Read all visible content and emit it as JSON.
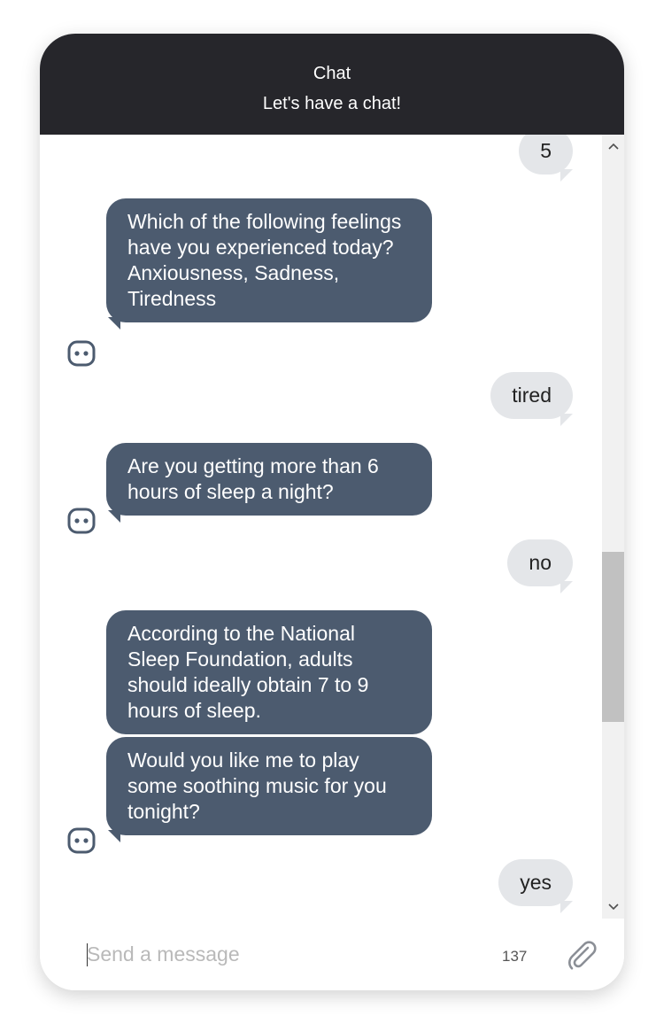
{
  "header": {
    "title": "Chat",
    "subtitle": "Let's have a chat!"
  },
  "messages": [
    {
      "role": "user",
      "text": "5"
    },
    {
      "role": "bot",
      "text": "Which of the following feelings have you experienced today? Anxiousness, Sadness, Tiredness"
    },
    {
      "role": "user",
      "text": "tired"
    },
    {
      "role": "bot",
      "text": "Are you getting more than 6 hours of sleep a night?"
    },
    {
      "role": "user",
      "text": "no"
    },
    {
      "role": "bot",
      "text": "According to the National Sleep Foundation, adults should ideally obtain 7 to 9 hours of sleep."
    },
    {
      "role": "bot",
      "text": "Would you like me to play some soothing music for you tonight?"
    },
    {
      "role": "user",
      "text": "yes"
    }
  ],
  "composer": {
    "placeholder": "Send a message",
    "value": "",
    "char_count": "137"
  },
  "icons": {
    "bot_avatar": "robot-face-icon",
    "attach": "paperclip-icon",
    "scroll_up": "chevron-up-icon",
    "scroll_down": "chevron-down-icon"
  },
  "colors": {
    "header_bg": "#26262b",
    "bot_bubble": "#4c5b6f",
    "user_bubble": "#e4e6e9"
  }
}
